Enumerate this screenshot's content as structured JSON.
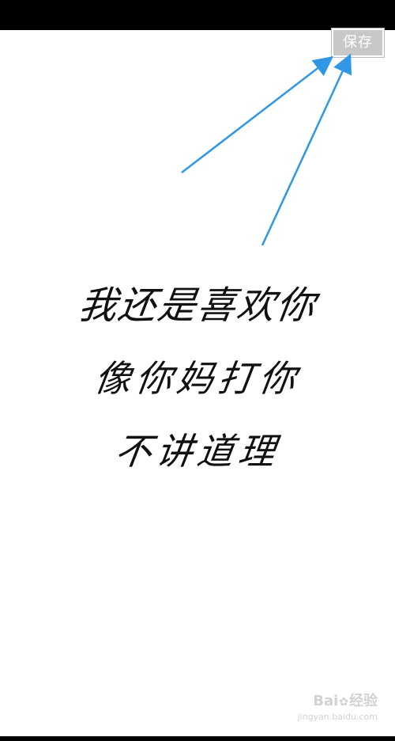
{
  "toolbar": {
    "save_label": "保存"
  },
  "handwriting": {
    "lines": [
      "我还是喜欢你",
      "像你妈打你",
      "不讲道理"
    ]
  },
  "watermark": {
    "brand_left": "Bai",
    "brand_right": "经验",
    "url": "jingyan.baidu.com"
  },
  "colors": {
    "arrow": "#2f97e6",
    "save_button_bg": "#c8c8c8"
  },
  "icons": {
    "watermark_paw": "paw-icon",
    "annotation_arrows": "arrow-icon"
  }
}
